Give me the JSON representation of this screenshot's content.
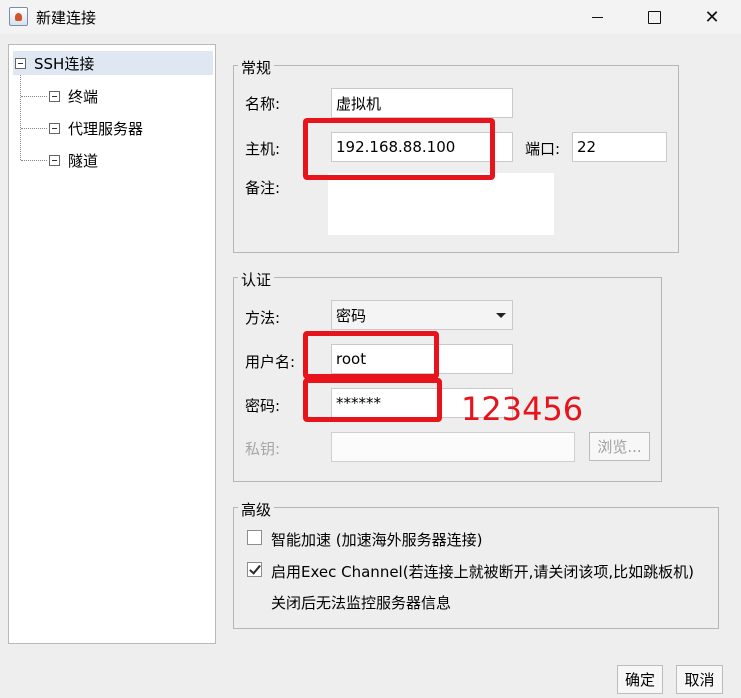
{
  "window": {
    "title": "新建连接",
    "minimize_icon": "minimize-icon",
    "maximize_icon": "maximize-icon",
    "close_glyph": "✕"
  },
  "tree": {
    "root": "SSH连接",
    "children": [
      "终端",
      "代理服务器",
      "隧道"
    ]
  },
  "general": {
    "legend": "常规",
    "name_label": "名称:",
    "name_value": "虚拟机",
    "host_label": "主机:",
    "host_value": "192.168.88.100",
    "port_label": "端口:",
    "port_value": "22",
    "note_label": "备注:",
    "note_value": ""
  },
  "auth": {
    "legend": "认证",
    "method_label": "方法:",
    "method_value": "密码",
    "username_label": "用户名:",
    "username_value": "root",
    "password_label": "密码:",
    "password_value": "******",
    "key_label": "私钥:",
    "key_value": "",
    "browse_button": "浏览..."
  },
  "advanced": {
    "legend": "高级",
    "smart_accel_label": "智能加速 (加速海外服务器连接)",
    "smart_accel_checked": false,
    "exec_channel_label": "启用Exec Channel(若连接上就被断开,请关闭该项,比如跳板机)",
    "exec_channel_checked": true,
    "exec_channel_note": "关闭后无法监控服务器信息"
  },
  "footer": {
    "ok_button": "确定",
    "cancel_button": "取消"
  },
  "annotation": {
    "password_hint": "123456",
    "color": "#e8141c"
  }
}
